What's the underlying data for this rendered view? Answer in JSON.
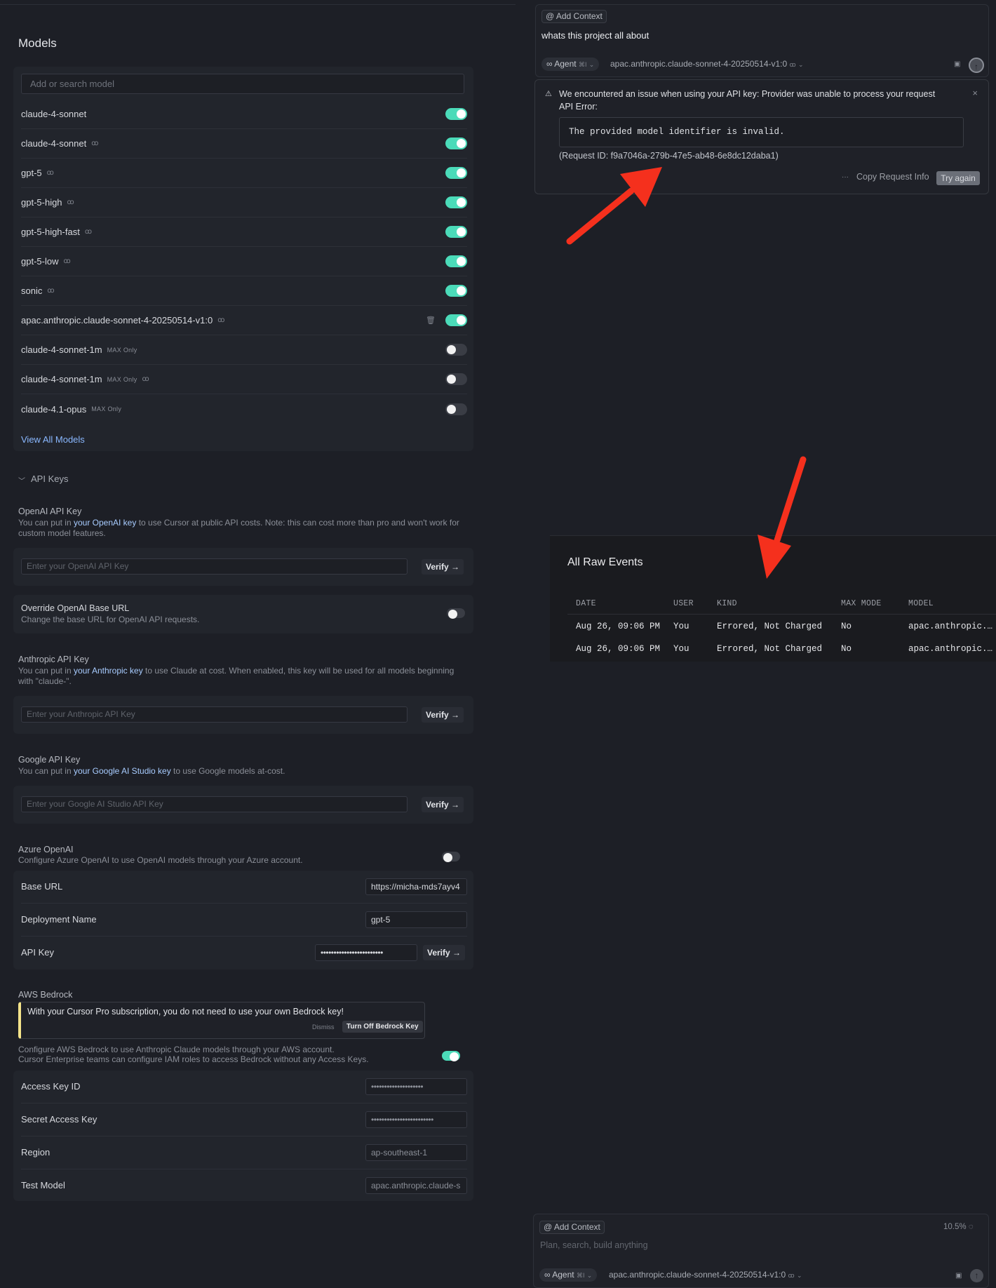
{
  "models_section": {
    "title": "Models",
    "search_placeholder": "Add or search model",
    "models": [
      {
        "name": "claude-4-sonnet",
        "thinking": false,
        "max_only": false,
        "enabled": true,
        "deletable": false
      },
      {
        "name": "claude-4-sonnet",
        "thinking": true,
        "max_only": false,
        "enabled": true,
        "deletable": false
      },
      {
        "name": "gpt-5",
        "thinking": true,
        "max_only": false,
        "enabled": true,
        "deletable": false
      },
      {
        "name": "gpt-5-high",
        "thinking": true,
        "max_only": false,
        "enabled": true,
        "deletable": false
      },
      {
        "name": "gpt-5-high-fast",
        "thinking": true,
        "max_only": false,
        "enabled": true,
        "deletable": false
      },
      {
        "name": "gpt-5-low",
        "thinking": true,
        "max_only": false,
        "enabled": true,
        "deletable": false
      },
      {
        "name": "sonic",
        "thinking": true,
        "max_only": false,
        "enabled": true,
        "deletable": false
      },
      {
        "name": "apac.anthropic.claude-sonnet-4-20250514-v1:0",
        "thinking": true,
        "max_only": false,
        "enabled": true,
        "deletable": true
      },
      {
        "name": "claude-4-sonnet-1m",
        "thinking": false,
        "max_only": true,
        "enabled": false,
        "deletable": false
      },
      {
        "name": "claude-4-sonnet-1m",
        "thinking": true,
        "max_only": true,
        "enabled": false,
        "deletable": false
      },
      {
        "name": "claude-4.1-opus",
        "thinking": false,
        "max_only": true,
        "enabled": false,
        "deletable": false
      }
    ],
    "max_badge": "MAX Only",
    "view_all": "View All Models"
  },
  "api_keys": {
    "section_label": "API Keys",
    "verify_label": "Verify →",
    "openai": {
      "title": "OpenAI API Key",
      "desc_pre": "You can put in ",
      "desc_link": "your OpenAI key",
      "desc_post": " to use Cursor at public API costs. Note: this can cost more than pro and won't work for custom model features.",
      "placeholder": "Enter your OpenAI API Key"
    },
    "override": {
      "title": "Override OpenAI Base URL",
      "desc": "Change the base URL for OpenAI API requests.",
      "enabled": false
    },
    "anthropic": {
      "title": "Anthropic API Key",
      "desc_pre": "You can put in ",
      "desc_link": "your Anthropic key",
      "desc_post": " to use Claude at cost. When enabled, this key will be used for all models beginning with \"claude-\".",
      "placeholder": "Enter your Anthropic API Key"
    },
    "google": {
      "title": "Google API Key",
      "desc_pre": "You can put in ",
      "desc_link": "your Google AI Studio key",
      "desc_post": " to use Google models at-cost.",
      "placeholder": "Enter your Google AI Studio API Key"
    },
    "azure": {
      "title": "Azure OpenAI",
      "desc": "Configure Azure OpenAI to use OpenAI models through your Azure account.",
      "enabled": false,
      "base_url_label": "Base URL",
      "base_url_value": "https://micha-mds7ayv4",
      "deployment_label": "Deployment Name",
      "deployment_value": "gpt-5",
      "api_key_label": "API Key",
      "api_key_value": "••••••••••••••••••••••••"
    },
    "bedrock": {
      "title": "AWS Bedrock",
      "notice": "With your Cursor Pro subscription, you do not need to use your own Bedrock key!",
      "dismiss": "Dismiss",
      "turn_off": "Turn Off Bedrock Key",
      "desc_line1": "Configure AWS Bedrock to use Anthropic Claude models through your AWS account.",
      "desc_line2": "Cursor Enterprise teams can configure IAM roles to access Bedrock without any Access Keys.",
      "enabled": true,
      "access_key_label": "Access Key ID",
      "access_key_value": "••••••••••••••••••••",
      "secret_label": "Secret Access Key",
      "secret_value": "••••••••••••••••••••••••",
      "region_label": "Region",
      "region_value": "ap-southeast-1",
      "test_model_label": "Test Model",
      "test_model_value": "apac.anthropic.claude-s"
    }
  },
  "chat_top": {
    "add_context": "@ Add Context",
    "message": "whats this project all about",
    "agent_label": "∞ Agent",
    "agent_shortcut": "⌘I",
    "model": "apac.anthropic.claude-sonnet-4-20250514-v1:0"
  },
  "error": {
    "message_line1": "We encountered an issue when using your API key: Provider was unable to process your request",
    "message_line2": "API Error:",
    "code": "The provided model identifier is invalid.",
    "request_id": "(Request ID: f9a7046a-279b-47e5-ab48-6e8dc12daba1)",
    "more": "···",
    "copy_label": "Copy Request Info",
    "try_label": "Try again"
  },
  "events": {
    "title": "All Raw Events",
    "columns": [
      "DATE",
      "USER",
      "KIND",
      "MAX MODE",
      "MODEL"
    ],
    "rows": [
      [
        "Aug 26, 09:06 PM",
        "You",
        "Errored, Not Charged",
        "No",
        "apac.anthropic.…"
      ],
      [
        "Aug 26, 09:06 PM",
        "You",
        "Errored, Not Charged",
        "No",
        "apac.anthropic.…"
      ]
    ]
  },
  "chat_bottom": {
    "add_context": "@ Add Context",
    "usage": "10.5%",
    "placeholder": "Plan, search, build anything",
    "agent_label": "∞ Agent",
    "agent_shortcut": "⌘I",
    "model": "apac.anthropic.claude-sonnet-4-20250514-v1:0"
  },
  "colors": {
    "toggle_on": "#4bdbb9",
    "link": "#8ab8ff",
    "arrow": "#f5301d",
    "notice_accent": "#f4e48a"
  }
}
